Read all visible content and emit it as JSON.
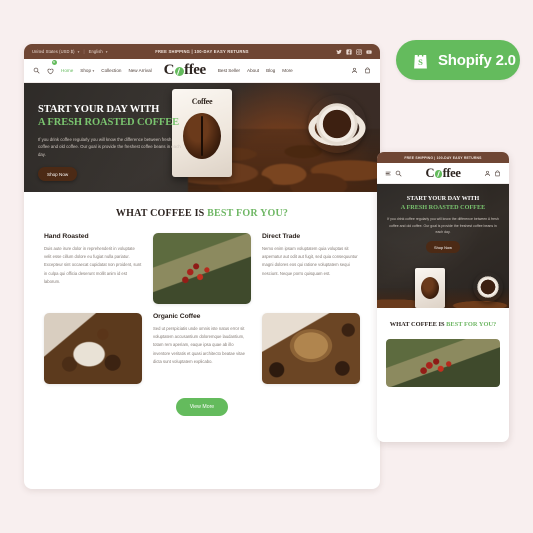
{
  "badge": {
    "label": "Shopify 2.0",
    "icon": "shopify-bag-icon",
    "color": "#64bb5d"
  },
  "desktop": {
    "topbar": {
      "country": "United States (USD $)",
      "language": "English",
      "promo": "FREE SHIPPING | 100-DAY EASY RETURNS",
      "socials": [
        "twitter-icon",
        "facebook-icon",
        "instagram-icon",
        "youtube-icon"
      ]
    },
    "nav": {
      "brand": "Coffee",
      "wishlist_count": "0",
      "links": [
        {
          "label": "Home",
          "active": true
        },
        {
          "label": "Shop",
          "caret": true
        },
        {
          "label": "Collection"
        },
        {
          "label": "New Arrival"
        }
      ],
      "links_right": [
        {
          "label": "Best Seller"
        },
        {
          "label": "About"
        },
        {
          "label": "Blog"
        },
        {
          "label": "More"
        }
      ]
    },
    "hero": {
      "title_line1": "START YOUR DAY WITH",
      "title_line2": "A FRESH ROASTED COFFEE",
      "paragraph": "If you drink coffee regularly you will know the difference between fresh coffee and old coffee. Our goal is provide the freshest coffee beans in each day.",
      "cta": "Shop Now",
      "pack_logo": "Coffee"
    },
    "section": {
      "title_dark": "WHAT COFFEE IS",
      "title_green": "BEST FOR YOU?",
      "features": [
        {
          "title": "Hand Roasted",
          "text": "Duis aute irure dolor in reprehenderit in voluptate velit esse cillum dolore eu fugiat nulla pariatur. Excepteur sint occaecat cupidatat non proident, sunt in culpa qui officia deserunt mollit anim id est laborum."
        },
        {
          "title": "Direct Trade",
          "text": "Nemo enim ipsam voluptatem quia voluptas sit aspernatur aut odit aut fugit, sed quia consequuntur magni dolores eos qui ratione voluptatem sequi nesciunt. Neque porro quisquam est."
        },
        {
          "title": "Organic Coffee",
          "text": "Sed ut perspiciatis unde omnis iste natus error sit voluptatem accusantium doloremque laudantium, totam rem aperiam, eaque ipsa quae ab illo inventore veritatis et quasi architecto beatae vitae dicta sunt voluptatem explicabo."
        }
      ],
      "images": [
        "coffee-cherries-harvest-image",
        "hand-holding-coffee-beans-image",
        "ground-coffee-bowl-image"
      ],
      "view_more": "View More"
    }
  },
  "mobile": {
    "promo": "FREE SHIPPING | 100-DAY EASY RETURNS",
    "brand": "Coffee",
    "hero": {
      "title_line1": "START YOUR DAY WITH",
      "title_line2": "A FRESH ROASTED COFFEE",
      "paragraph": "If you drink coffee regularly you will know the difference between A fresh coffee and old coffee. Our goal is provide the freshest coffee beans in each day.",
      "cta": "Shop Now"
    },
    "section": {
      "title_dark": "WHAT COFFEE IS",
      "title_green": "BEST FOR YOU?",
      "image": "coffee-cherries-harvest-image"
    }
  }
}
